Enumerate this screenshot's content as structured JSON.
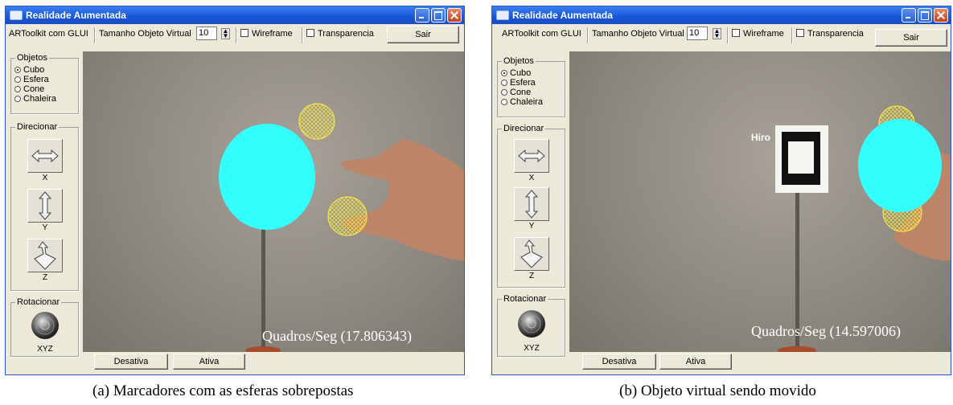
{
  "panels": [
    {
      "window_title": "Realidade Aumentada",
      "toolbar": {
        "glui_label": "ARToolkit com GLUI",
        "size_label": "Tamanho Objeto Virtual",
        "size_value": "10",
        "wireframe_label": "Wireframe",
        "transparency_label": "Transparencia",
        "exit_label": "Sair"
      },
      "objects_group": {
        "title": "Objetos",
        "options": [
          "Cubo",
          "Esfera",
          "Cone",
          "Chaleira"
        ],
        "selected": "Cubo"
      },
      "direction_group": {
        "title": "Direcionar",
        "axes": [
          "X",
          "Y",
          "Z"
        ]
      },
      "rotation_group": {
        "title": "Rotacionar",
        "axis": "XYZ"
      },
      "fps_text": "Quadros/Seg (17.806343)",
      "bottom": {
        "deactivate_label": "Desativa",
        "activate_label": "Ativa"
      },
      "caption": "(a) Marcadores com as esferas sobrepostas"
    },
    {
      "window_title": "Realidade Aumentada",
      "toolbar": {
        "glui_label": "ARToolkit com GLUI",
        "size_label": "Tamanho Objeto Virtual",
        "size_value": "10",
        "wireframe_label": "Wireframe",
        "transparency_label": "Transparencia",
        "exit_label": "Sair"
      },
      "objects_group": {
        "title": "Objetos",
        "options": [
          "Cubo",
          "Esfera",
          "Cone",
          "Chaleira"
        ],
        "selected": "Cubo"
      },
      "direction_group": {
        "title": "Direcionar",
        "axes": [
          "X",
          "Y",
          "Z"
        ]
      },
      "rotation_group": {
        "title": "Rotacionar",
        "axis": "XYZ"
      },
      "marker_text": "Hiro",
      "fps_text": "Quadros/Seg (14.597006)",
      "bottom": {
        "deactivate_label": "Desativa",
        "activate_label": "Ativa"
      },
      "caption": "(b) Objeto virtual sendo movido"
    }
  ],
  "colors": {
    "sphere": "#33ffff",
    "wireframe": "#f2e34a",
    "title_bar": "#1656d8"
  }
}
